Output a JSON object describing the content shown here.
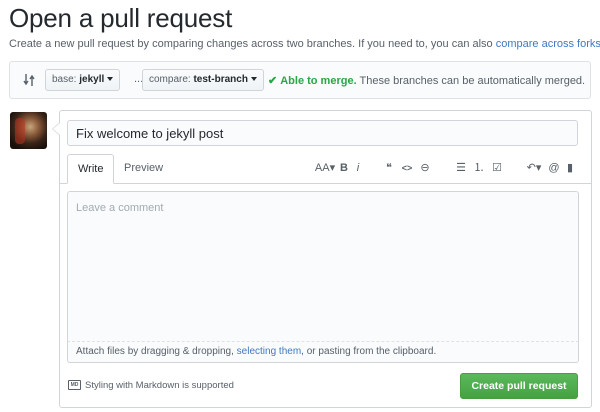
{
  "page": {
    "title": "Open a pull request",
    "subtitle": "Create a new pull request by comparing changes across two branches. If you need to, you can also",
    "subtitle_link": "compare across forks."
  },
  "compare": {
    "base_label": "base:",
    "base_branch": "jekyll",
    "separator": "...",
    "compare_label": "compare:",
    "compare_branch": "test-branch",
    "merge_status": "Able to merge.",
    "merge_detail": "These branches can be automatically merged."
  },
  "form": {
    "title_value": "Fix welcome to jekyll post",
    "tabs": [
      {
        "label": "Write",
        "active": true
      },
      {
        "label": "Preview",
        "active": false
      }
    ],
    "toolbar": [
      {
        "icon": "text-size-icon",
        "glyph": "AA▾"
      },
      {
        "icon": "bold-icon",
        "glyph": "B"
      },
      {
        "icon": "italic-icon",
        "glyph": "i"
      },
      {
        "icon": "quote-icon",
        "glyph": "❝"
      },
      {
        "icon": "code-icon",
        "glyph": "<>"
      },
      {
        "icon": "link-icon",
        "glyph": "⊖"
      },
      {
        "icon": "unordered-list-icon",
        "glyph": "☰"
      },
      {
        "icon": "ordered-list-icon",
        "glyph": "⒈"
      },
      {
        "icon": "task-list-icon",
        "glyph": "☑"
      },
      {
        "icon": "reply-icon",
        "glyph": "↶▾"
      },
      {
        "icon": "mention-icon",
        "glyph": "@"
      },
      {
        "icon": "bookmark-icon",
        "glyph": "▮"
      }
    ],
    "comment_placeholder": "Leave a comment",
    "attach_prefix": "Attach files by dragging & dropping,",
    "attach_link": "selecting them",
    "attach_suffix": ", or pasting from the clipboard.",
    "markdown_badge": "MD",
    "markdown_note": "Styling with Markdown is supported",
    "submit_label": "Create pull request"
  },
  "colors": {
    "link": "#4078c0",
    "success": "#28a745",
    "button_green": "#5cb85c"
  }
}
